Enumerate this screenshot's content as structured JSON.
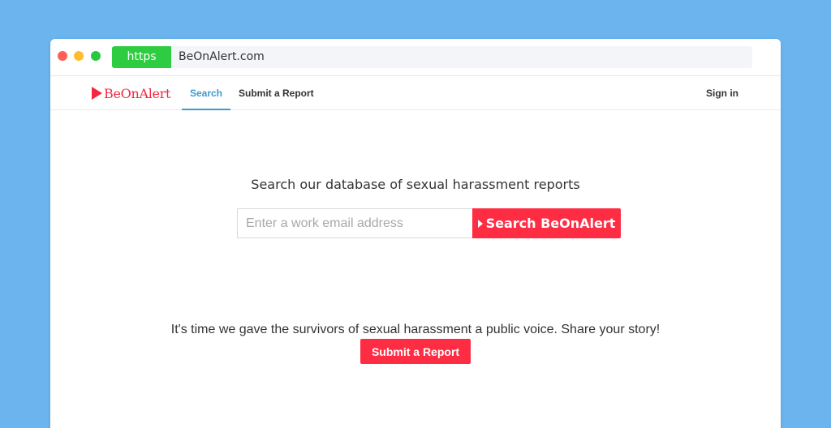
{
  "browser": {
    "protocol_badge": "https",
    "url": "BeOnAlert.com"
  },
  "nav": {
    "logo_text": "BeOnAlert",
    "tabs": [
      {
        "label": "Search",
        "active": true
      },
      {
        "label": "Submit a Report",
        "active": false
      }
    ],
    "sign_in_label": "Sign in"
  },
  "search": {
    "headline": "Search our database of sexual harassment reports",
    "placeholder": "Enter a work email address",
    "value": "",
    "button_label": "Search BeOnAlert",
    "button_icon": "play-icon"
  },
  "cta": {
    "text": "It's time we gave the survivors of sexual harassment a public voice. Share your story!",
    "button_label": "Submit a Report"
  },
  "colors": {
    "background": "#6cb4ee",
    "brand_red": "#ff2d44",
    "active_tab_blue": "#3d9ad1",
    "https_green": "#2ecc40"
  }
}
